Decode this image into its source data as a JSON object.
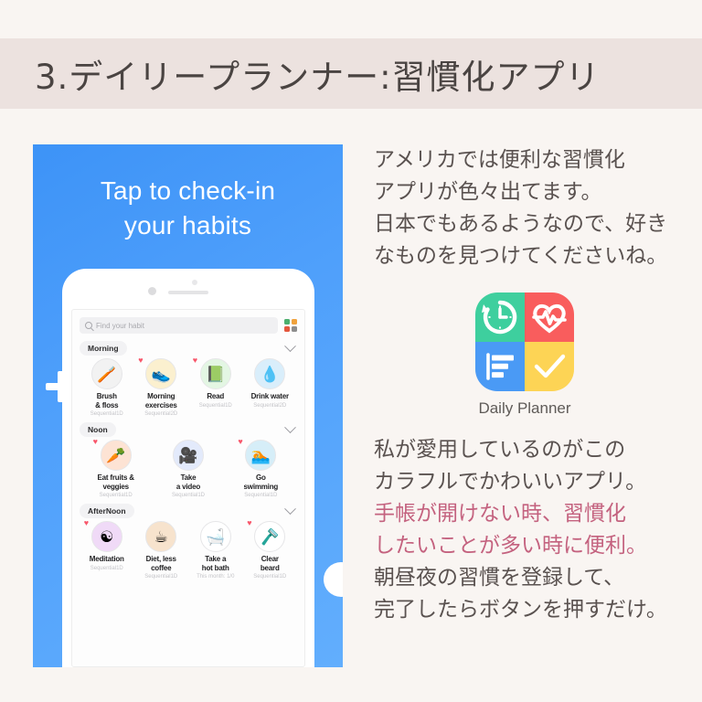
{
  "colors": {
    "background": "#f9f5f2",
    "banner": "#ece2df",
    "title_text": "#4a4442",
    "body_text": "#5a5250",
    "highlight": "#c4627f",
    "phone_blue_dark": "#3d93f7",
    "phone_blue_light": "#62aefd",
    "icon_green": "#3ecf9e",
    "icon_red": "#f95d5d",
    "icon_blue": "#4a9af5",
    "icon_yellow": "#fdd455",
    "heart_red": "#f8576b"
  },
  "header": {
    "title": "3.デイリープランナー:習慣化アプリ"
  },
  "phone": {
    "headline_line1": "Tap to check-in",
    "headline_line2": "your habits",
    "add_icon": "plus-icon",
    "side_button": "side-circle",
    "app": {
      "search": {
        "icon": "search-icon",
        "placeholder": "Find your habit",
        "grid_icon": "grid-view-icon",
        "grid_colors": [
          "#4caf6e",
          "#f0a23c",
          "#e4573d",
          "#8d8d8d"
        ]
      },
      "sections": [
        {
          "label": "Morning",
          "chevron": "chevron-down-icon",
          "habits": [
            {
              "name": "Brush\n& floss",
              "sub": "Sequential1D",
              "glyph": "🪥",
              "circle_bg": "#f2f2f2",
              "favorite": false
            },
            {
              "name": "Morning\nexercises",
              "sub": "Sequential2D",
              "glyph": "👟",
              "circle_bg": "#fbf0cf",
              "favorite": true
            },
            {
              "name": "Read",
              "sub": "Sequential1D",
              "glyph": "📗",
              "circle_bg": "#e3f6e3",
              "favorite": true
            },
            {
              "name": "Drink water",
              "sub": "Sequential2D",
              "glyph": "💧",
              "circle_bg": "#d9eefb",
              "favorite": false
            }
          ]
        },
        {
          "label": "Noon",
          "chevron": "chevron-down-icon",
          "habits": [
            {
              "name": "Eat fruits &\nveggies",
              "sub": "Sequential1D",
              "glyph": "🥕",
              "circle_bg": "#fde3d4",
              "favorite": true
            },
            {
              "name": "Take\na video",
              "sub": "Sequential1D",
              "glyph": "🎥",
              "circle_bg": "#e3eafb",
              "favorite": false
            },
            {
              "name": "Go\nswimming",
              "sub": "Sequential1D",
              "glyph": "🏊",
              "circle_bg": "#d6eef8",
              "favorite": true
            }
          ]
        },
        {
          "label": "AfterNoon",
          "chevron": "chevron-down-icon",
          "habits": [
            {
              "name": "Meditation",
              "sub": "Sequential1D",
              "glyph": "☯",
              "circle_bg": "#f0daf7",
              "favorite": true
            },
            {
              "name": "Diet, less\ncoffee",
              "sub": "Sequential1D",
              "glyph": "☕",
              "circle_bg": "#f7e3cd",
              "favorite": false
            },
            {
              "name": "Take a\nhot bath",
              "sub": "This month: 1/0",
              "glyph": "🛁",
              "circle_bg": "#ffffff",
              "favorite": false
            },
            {
              "name": "Clear\nbeard",
              "sub": "Sequential1D",
              "glyph": "🪒",
              "circle_bg": "#ffffff",
              "favorite": true
            }
          ]
        }
      ]
    }
  },
  "right": {
    "paragraph1": [
      {
        "text": "アメリカでは便利な習慣化",
        "highlight": false
      },
      {
        "text": "アプリが色々出てます。",
        "highlight": false
      },
      {
        "text": "日本でもあるようなので、好き",
        "highlight": false
      },
      {
        "text": "なものを見つけてくださいね。",
        "highlight": false
      }
    ],
    "app_icon": {
      "name": "daily-planner-app-icon",
      "label": "Daily Planner",
      "quadrants": [
        {
          "position": "top-left",
          "color": "#3ecf9e",
          "icon": "clock-refresh-icon"
        },
        {
          "position": "top-right",
          "color": "#f95d5d",
          "icon": "heart-pulse-icon"
        },
        {
          "position": "bottom-left",
          "color": "#4a9af5",
          "icon": "list-bars-icon"
        },
        {
          "position": "bottom-right",
          "color": "#fdd455",
          "icon": "checkmark-icon"
        }
      ]
    },
    "paragraph2": [
      {
        "text": "私が愛用しているのがこの",
        "highlight": false
      },
      {
        "text": "カラフルでかわいいアプリ。",
        "highlight": false
      },
      {
        "text": "手帳が開けない時、習慣化",
        "highlight": true
      },
      {
        "text": "したいことが多い時に便利。",
        "highlight": true
      },
      {
        "text": "朝昼夜の習慣を登録して、",
        "highlight": false
      },
      {
        "text": "完了したらボタンを押すだけ。",
        "highlight": false
      }
    ]
  }
}
